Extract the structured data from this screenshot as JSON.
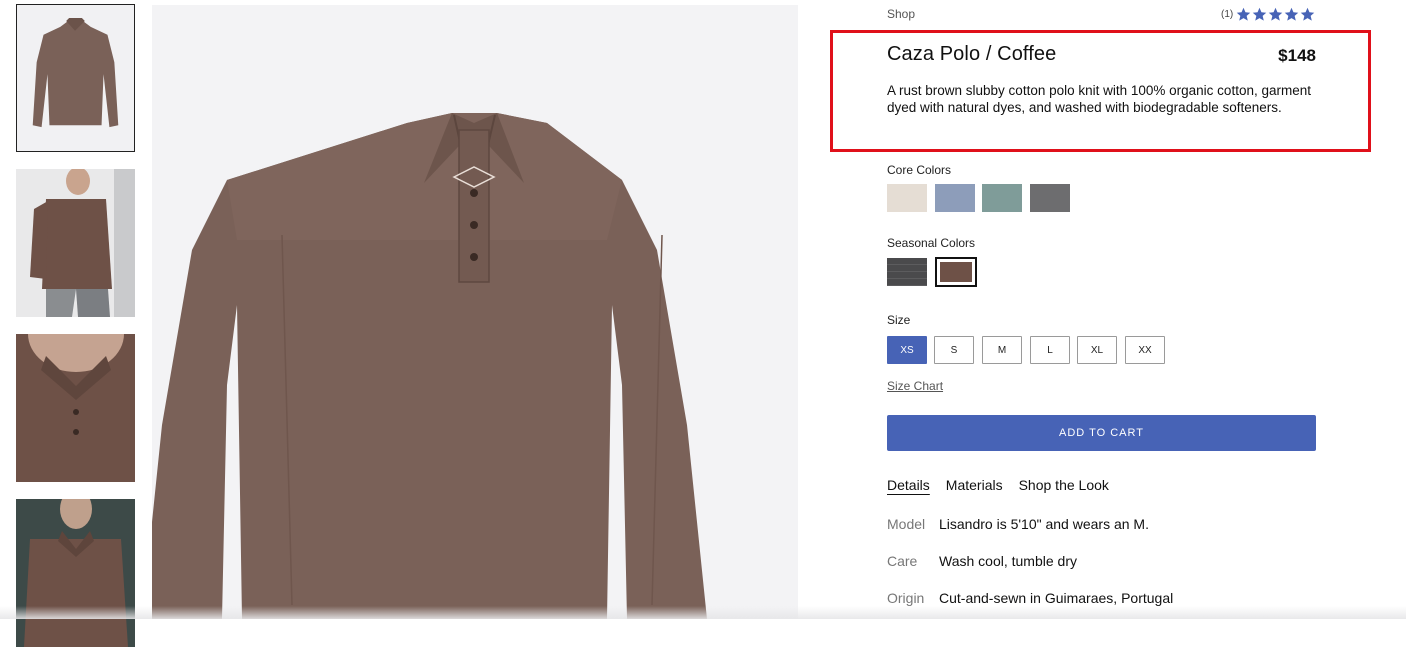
{
  "breadcrumb": "Shop",
  "rating": {
    "count": "(1)",
    "stars": 5,
    "color": "#4763b6"
  },
  "product": {
    "title": "Caza Polo / Coffee",
    "price": "$148",
    "description": "A rust brown slubby cotton polo knit with 100% organic cotton, garment dyed with natural dyes, and washed with biodegradable softeners."
  },
  "core_colors": {
    "label": "Core Colors",
    "swatches": [
      "#e5ddd4",
      "#8d9dba",
      "#7f9c99",
      "#6d6d6f"
    ]
  },
  "seasonal_colors": {
    "label": "Seasonal Colors",
    "swatches": [
      "#4a4a4c",
      "#6e5147"
    ],
    "selected_index": 1
  },
  "size": {
    "label": "Size",
    "options": [
      "XS",
      "S",
      "M",
      "L",
      "XL",
      "XX"
    ],
    "selected": "XS"
  },
  "size_chart_label": "Size Chart",
  "add_to_cart_label": "ADD TO CART",
  "tabs": [
    "Details",
    "Materials",
    "Shop the Look"
  ],
  "active_tab": "Details",
  "details": [
    {
      "key": "Model",
      "value": "Lisandro is 5'10\" and wears an M."
    },
    {
      "key": "Care",
      "value": "Wash cool, tumble dry"
    },
    {
      "key": "Origin",
      "value": "Cut-and-sewn in Guimaraes, Portugal"
    }
  ],
  "colors": {
    "accent": "#4763b6",
    "highlight": "#e0101a",
    "garment": "#7a6158"
  }
}
